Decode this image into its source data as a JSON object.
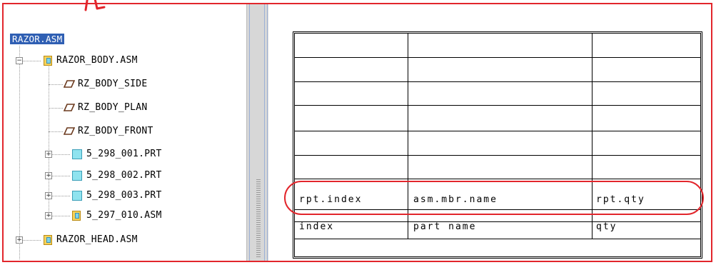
{
  "tree": {
    "root": "RAZOR.ASM",
    "items": [
      {
        "label": "RAZOR_BODY.ASM",
        "type": "asm",
        "level": 1,
        "expanded": true
      },
      {
        "label": "RZ_BODY_SIDE",
        "type": "plane",
        "level": 2
      },
      {
        "label": "RZ_BODY_PLAN",
        "type": "plane",
        "level": 2
      },
      {
        "label": "RZ_BODY_FRONT",
        "type": "plane",
        "level": 2
      },
      {
        "label": "5_298_001.PRT",
        "type": "prt",
        "level": 2
      },
      {
        "label": "5_298_002.PRT",
        "type": "prt",
        "level": 2
      },
      {
        "label": "5_298_003.PRT",
        "type": "prt",
        "level": 2
      },
      {
        "label": "5_297_010.ASM",
        "type": "asm",
        "level": 2
      },
      {
        "label": "RAZOR_HEAD.ASM",
        "type": "asm",
        "level": 1
      }
    ]
  },
  "table": {
    "param_row": [
      "rpt.index",
      "asm.mbr.name",
      "rpt.qty"
    ],
    "header_row": [
      "index",
      "part name",
      "qty"
    ]
  },
  "colors": {
    "frame": "#e2262c",
    "selection": "#2f5fb3"
  }
}
